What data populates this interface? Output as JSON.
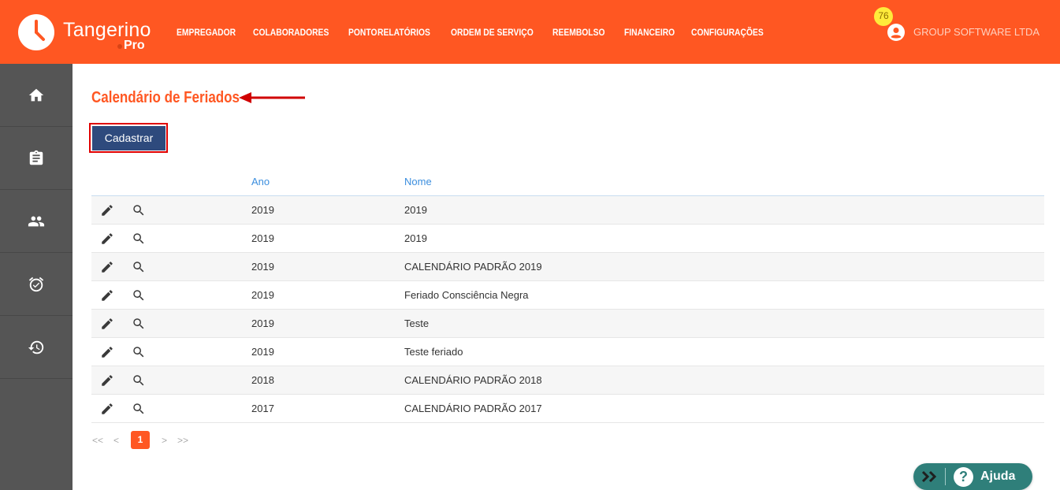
{
  "header": {
    "brand": "Tangerino",
    "brand_sub": "Pro",
    "nav": [
      "EMPREGADOR",
      "COLABORADORES",
      "PONTO",
      "RELATÓRIOS",
      "ORDEM DE SERVIÇO",
      "REEMBOLSO",
      "FINANCEIRO",
      "CONFIGURAÇÕES"
    ],
    "notification_count": "76",
    "company": "GROUP SOFTWARE LTDA"
  },
  "sidebar": {
    "items": [
      "home-icon",
      "clipboard-icon",
      "people-icon",
      "alarm-icon",
      "history-icon"
    ]
  },
  "page": {
    "title": "Calendário de Feriados",
    "register_button": "Cadastrar"
  },
  "table": {
    "columns": [
      "Ano",
      "Nome"
    ],
    "rows": [
      {
        "year": "2019",
        "name": "2019"
      },
      {
        "year": "2019",
        "name": "2019"
      },
      {
        "year": "2019",
        "name": "CALENDÁRIO PADRÃO 2019"
      },
      {
        "year": "2019",
        "name": "Feriado Consciência Negra"
      },
      {
        "year": "2019",
        "name": "Teste"
      },
      {
        "year": "2019",
        "name": "Teste feriado"
      },
      {
        "year": "2018",
        "name": "CALENDÁRIO PADRÃO 2018"
      },
      {
        "year": "2017",
        "name": "CALENDÁRIO PADRÃO 2017"
      }
    ]
  },
  "pagination": {
    "first": "<<",
    "prev": "<",
    "current": "1",
    "next": ">",
    "last": ">>"
  },
  "help": {
    "label": "Ajuda"
  },
  "colors": {
    "accent": "#ff5722",
    "sidebar": "#555555",
    "button": "#2e4a7d",
    "link": "#3b8ede",
    "help": "#2f7f7a"
  }
}
